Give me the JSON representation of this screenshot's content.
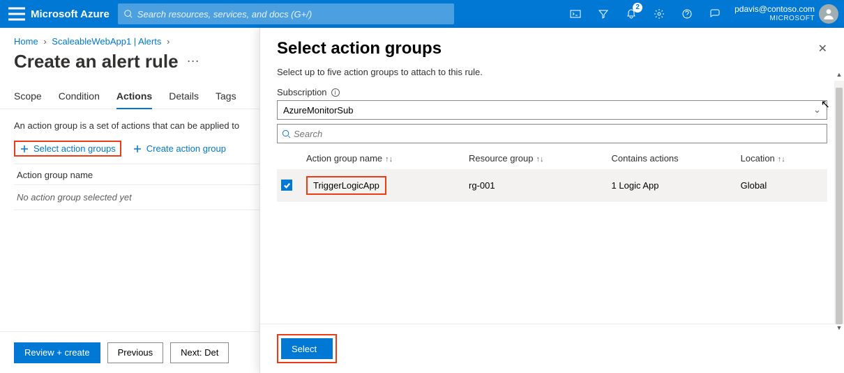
{
  "header": {
    "brand": "Microsoft Azure",
    "search_placeholder": "Search resources, services, and docs (G+/)",
    "notification_count": "2",
    "user_email": "pdavis@contoso.com",
    "user_org": "MICROSOFT"
  },
  "breadcrumb": {
    "items": [
      "Home",
      "ScaleableWebApp1 | Alerts"
    ]
  },
  "page": {
    "title": "Create an alert rule",
    "tabs": [
      "Scope",
      "Condition",
      "Actions",
      "Details",
      "Tags"
    ],
    "active_tab_index": 2,
    "help_text": "An action group is a set of actions that can be applied to",
    "select_action_groups_label": "Select action groups",
    "create_action_group_label": "Create action group",
    "col_header": "Action group name",
    "empty_text": "No action group selected yet"
  },
  "footer": {
    "review_label": "Review + create",
    "prev_label": "Previous",
    "next_label": "Next: Det"
  },
  "panel": {
    "title": "Select action groups",
    "help": "Select up to five action groups to attach to this rule.",
    "subscription_label": "Subscription",
    "subscription_value": "AzureMonitorSub",
    "search_placeholder": "Search",
    "columns": {
      "name": "Action group name",
      "rg": "Resource group",
      "contains": "Contains actions",
      "loc": "Location"
    },
    "rows": [
      {
        "checked": true,
        "name": "TriggerLogicApp",
        "rg": "rg-001",
        "contains": "1 Logic App",
        "loc": "Global"
      }
    ],
    "select_btn": "Select"
  }
}
